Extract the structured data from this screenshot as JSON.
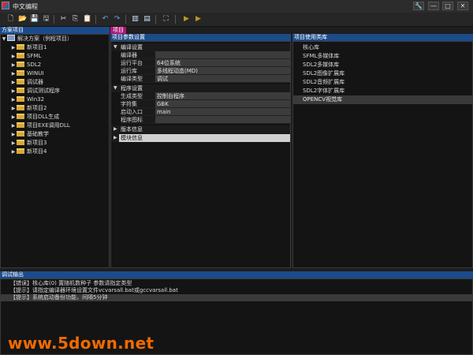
{
  "window": {
    "title": "中文编程",
    "controls": [
      "🔧",
      "—",
      "□",
      "✕"
    ]
  },
  "toolbar": {
    "icons": [
      "new-file-icon",
      "open-folder-icon",
      "save-icon",
      "save-all-icon",
      "cut-icon",
      "copy-icon",
      "paste-icon",
      "undo-icon",
      "redo-icon",
      "panel-icon",
      "layout-icon",
      "find-icon",
      "run-icon",
      "debug-icon"
    ]
  },
  "solution_panel": {
    "header": "方案项目",
    "root": "解决方案（例程项目）",
    "items": [
      "新项目1",
      "SFML",
      "SDL2",
      "WINUI",
      "调试器",
      "调试测试程序",
      "Win32",
      "新项目2",
      "项目DLL生成",
      "项目EXE调用DLL",
      "基础教学",
      "新项目3",
      "新项目4"
    ]
  },
  "project_tab": {
    "label": "项目"
  },
  "settings_panel": {
    "header": "项目参数设置",
    "groups": [
      {
        "name": "编译设置",
        "expanded": true,
        "rows": [
          {
            "name": "编译器",
            "value": ""
          },
          {
            "name": "运行平台",
            "value": "64位系统"
          },
          {
            "name": "运行库",
            "value": "多线程动态(MD)"
          },
          {
            "name": "编译类型",
            "value": "调试"
          }
        ]
      },
      {
        "name": "程序设置",
        "expanded": true,
        "rows": [
          {
            "name": "生成类型",
            "value": "控制台程序"
          },
          {
            "name": "字符集",
            "value": "GBK"
          },
          {
            "name": "启动入口",
            "value": "main"
          },
          {
            "name": "程序图标",
            "value": ""
          }
        ]
      },
      {
        "name": "版本信息",
        "expanded": false,
        "rows": []
      },
      {
        "name": "模块信息",
        "expanded": false,
        "selected": true,
        "rows": []
      }
    ]
  },
  "library_panel": {
    "header": "项目使用类库",
    "items": [
      "核心库",
      "SFML多媒体库",
      "SDL2多媒体库",
      "SDL2图像扩展库",
      "SDL2音频扩展库",
      "SDL2字体扩展库",
      "OPENCV视觉库"
    ],
    "selected_index": 6
  },
  "output_panel": {
    "header": "调试输出",
    "lines": [
      "【错误】核心库(0) 置随机数种子 参数请指定类型",
      "【提示】请指定编译器环境设置文件vcvarsall.bat或gccvarsall.bat",
      "【提示】系统启动备份功能，间隔5分钟"
    ],
    "selected_index": 2
  },
  "watermark": {
    "text": "www.5down.net"
  },
  "colors": {
    "header_blue": "#1c4b8a",
    "folder": "#d8a93b",
    "watermark": "#f06a00",
    "tab_magenta": "#b0157a"
  }
}
